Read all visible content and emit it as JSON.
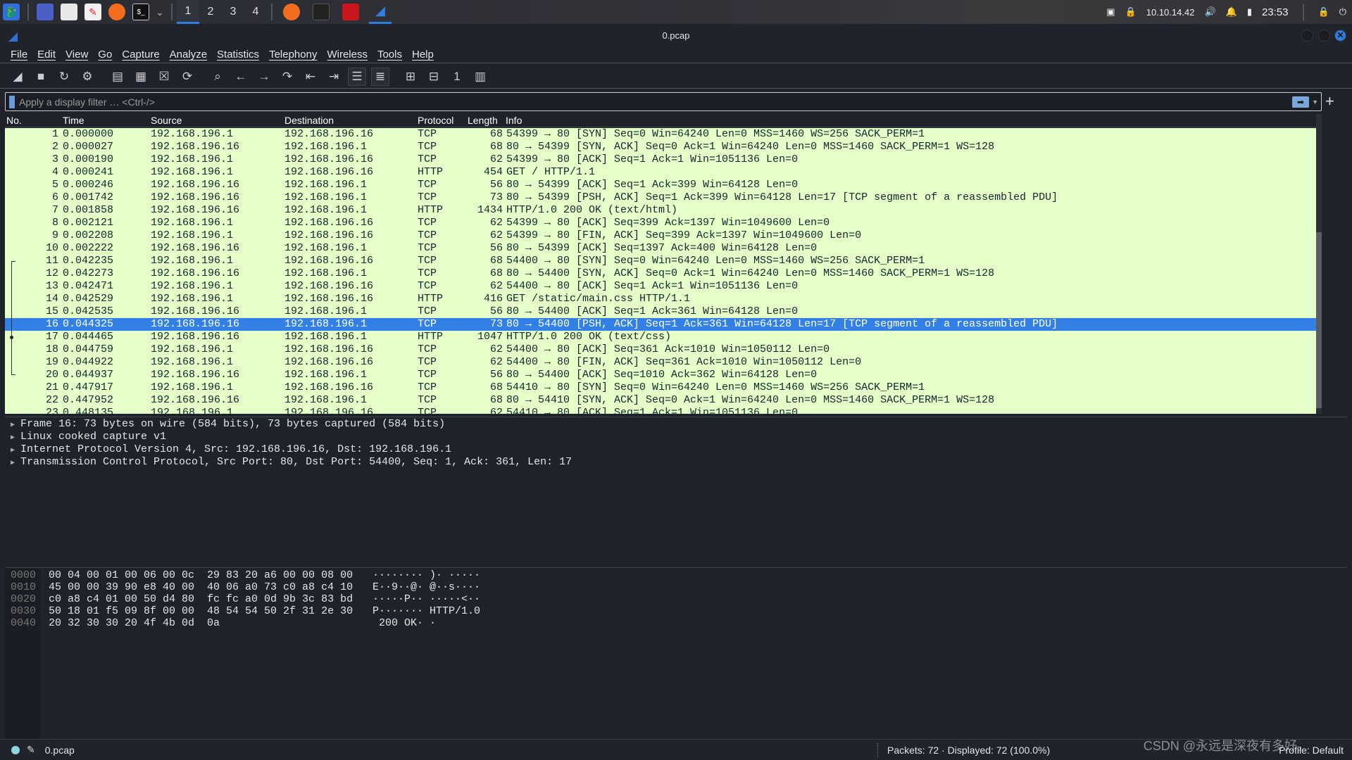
{
  "taskbar": {
    "workspaces": [
      "1",
      "2",
      "3",
      "4"
    ],
    "active_workspace": "1",
    "ip": "10.10.14.42",
    "time": "23:53"
  },
  "window": {
    "title": "0.pcap"
  },
  "menu": [
    "File",
    "Edit",
    "View",
    "Go",
    "Capture",
    "Analyze",
    "Statistics",
    "Telephony",
    "Wireless",
    "Tools",
    "Help"
  ],
  "toolbar": [
    "shark-fin-start-icon",
    "stop-icon",
    "restart-icon",
    "options-gear-icon",
    "open-file-icon",
    "save-file-icon",
    "close-file-icon",
    "reload-icon",
    "find-icon",
    "back-arrow-icon",
    "forward-arrow-icon",
    "go-to-packet-icon",
    "first-packet-icon",
    "last-packet-icon",
    "autoscroll-icon",
    "colorize-icon",
    "zoom-in-icon",
    "zoom-out-icon",
    "normal-size-icon",
    "resize-columns-icon"
  ],
  "filter": {
    "placeholder": "Apply a display filter … <Ctrl-/>",
    "value": ""
  },
  "columns": {
    "no": "No.",
    "time": "Time",
    "source": "Source",
    "destination": "Destination",
    "protocol": "Protocol",
    "length": "Length",
    "info": "Info"
  },
  "selected_packet": 16,
  "packets": [
    [
      "1",
      "0.000000",
      "192.168.196.1",
      "192.168.196.16",
      "TCP",
      "68",
      "54399 → 80 [SYN] Seq=0 Win=64240 Len=0 MSS=1460 WS=256 SACK_PERM=1"
    ],
    [
      "2",
      "0.000027",
      "192.168.196.16",
      "192.168.196.1",
      "TCP",
      "68",
      "80 → 54399 [SYN, ACK] Seq=0 Ack=1 Win=64240 Len=0 MSS=1460 SACK_PERM=1 WS=128"
    ],
    [
      "3",
      "0.000190",
      "192.168.196.1",
      "192.168.196.16",
      "TCP",
      "62",
      "54399 → 80 [ACK] Seq=1 Ack=1 Win=1051136 Len=0"
    ],
    [
      "4",
      "0.000241",
      "192.168.196.1",
      "192.168.196.16",
      "HTTP",
      "454",
      "GET / HTTP/1.1"
    ],
    [
      "5",
      "0.000246",
      "192.168.196.16",
      "192.168.196.1",
      "TCP",
      "56",
      "80 → 54399 [ACK] Seq=1 Ack=399 Win=64128 Len=0"
    ],
    [
      "6",
      "0.001742",
      "192.168.196.16",
      "192.168.196.1",
      "TCP",
      "73",
      "80 → 54399 [PSH, ACK] Seq=1 Ack=399 Win=64128 Len=17 [TCP segment of a reassembled PDU]"
    ],
    [
      "7",
      "0.001858",
      "192.168.196.16",
      "192.168.196.1",
      "HTTP",
      "1434",
      "HTTP/1.0 200 OK  (text/html)"
    ],
    [
      "8",
      "0.002121",
      "192.168.196.1",
      "192.168.196.16",
      "TCP",
      "62",
      "54399 → 80 [ACK] Seq=399 Ack=1397 Win=1049600 Len=0"
    ],
    [
      "9",
      "0.002208",
      "192.168.196.1",
      "192.168.196.16",
      "TCP",
      "62",
      "54399 → 80 [FIN, ACK] Seq=399 Ack=1397 Win=1049600 Len=0"
    ],
    [
      "10",
      "0.002222",
      "192.168.196.16",
      "192.168.196.1",
      "TCP",
      "56",
      "80 → 54399 [ACK] Seq=1397 Ack=400 Win=64128 Len=0"
    ],
    [
      "11",
      "0.042235",
      "192.168.196.1",
      "192.168.196.16",
      "TCP",
      "68",
      "54400 → 80 [SYN] Seq=0 Win=64240 Len=0 MSS=1460 WS=256 SACK_PERM=1"
    ],
    [
      "12",
      "0.042273",
      "192.168.196.16",
      "192.168.196.1",
      "TCP",
      "68",
      "80 → 54400 [SYN, ACK] Seq=0 Ack=1 Win=64240 Len=0 MSS=1460 SACK_PERM=1 WS=128"
    ],
    [
      "13",
      "0.042471",
      "192.168.196.1",
      "192.168.196.16",
      "TCP",
      "62",
      "54400 → 80 [ACK] Seq=1 Ack=1 Win=1051136 Len=0"
    ],
    [
      "14",
      "0.042529",
      "192.168.196.1",
      "192.168.196.16",
      "HTTP",
      "416",
      "GET /static/main.css HTTP/1.1"
    ],
    [
      "15",
      "0.042535",
      "192.168.196.16",
      "192.168.196.1",
      "TCP",
      "56",
      "80 → 54400 [ACK] Seq=1 Ack=361 Win=64128 Len=0"
    ],
    [
      "16",
      "0.044325",
      "192.168.196.16",
      "192.168.196.1",
      "TCP",
      "73",
      "80 → 54400 [PSH, ACK] Seq=1 Ack=361 Win=64128 Len=17 [TCP segment of a reassembled PDU]"
    ],
    [
      "17",
      "0.044465",
      "192.168.196.16",
      "192.168.196.1",
      "HTTP",
      "1047",
      "HTTP/1.0 200 OK  (text/css)"
    ],
    [
      "18",
      "0.044759",
      "192.168.196.1",
      "192.168.196.16",
      "TCP",
      "62",
      "54400 → 80 [ACK] Seq=361 Ack=1010 Win=1050112 Len=0"
    ],
    [
      "19",
      "0.044922",
      "192.168.196.1",
      "192.168.196.16",
      "TCP",
      "62",
      "54400 → 80 [FIN, ACK] Seq=361 Ack=1010 Win=1050112 Len=0"
    ],
    [
      "20",
      "0.044937",
      "192.168.196.16",
      "192.168.196.1",
      "TCP",
      "56",
      "80 → 54400 [ACK] Seq=1010 Ack=362 Win=64128 Len=0"
    ],
    [
      "21",
      "0.447917",
      "192.168.196.1",
      "192.168.196.16",
      "TCP",
      "68",
      "54410 → 80 [SYN] Seq=0 Win=64240 Len=0 MSS=1460 WS=256 SACK_PERM=1"
    ],
    [
      "22",
      "0.447952",
      "192.168.196.16",
      "192.168.196.1",
      "TCP",
      "68",
      "80 → 54410 [SYN, ACK] Seq=0 Ack=1 Win=64240 Len=0 MSS=1460 SACK_PERM=1 WS=128"
    ],
    [
      "23",
      "0.448135",
      "192.168.196.1",
      "192.168.196.16",
      "TCP",
      "62",
      "54410 → 80 [ACK] Seq=1 Ack=1 Win=1051136 Len=0"
    ]
  ],
  "details": [
    "Frame 16: 73 bytes on wire (584 bits), 73 bytes captured (584 bits)",
    "Linux cooked capture v1",
    "Internet Protocol Version 4, Src: 192.168.196.16, Dst: 192.168.196.1",
    "Transmission Control Protocol, Src Port: 80, Dst Port: 54400, Seq: 1, Ack: 361, Len: 17"
  ],
  "hex": [
    {
      "offset": "0000",
      "bytes": "00 04 00 01 00 06 00 0c  29 83 20 a6 00 00 08 00",
      "ascii": "········ )· ·····"
    },
    {
      "offset": "0010",
      "bytes": "45 00 00 39 90 e8 40 00  40 06 a0 73 c0 a8 c4 10",
      "ascii": "E··9··@· @··s····"
    },
    {
      "offset": "0020",
      "bytes": "c0 a8 c4 01 00 50 d4 80  fc fc a0 0d 9b 3c 83 bd",
      "ascii": "·····P·· ·····<··"
    },
    {
      "offset": "0030",
      "bytes": "50 18 01 f5 09 8f 00 00  48 54 54 50 2f 31 2e 30",
      "ascii": "P······· HTTP/1.0"
    },
    {
      "offset": "0040",
      "bytes": "20 32 30 30 20 4f 4b 0d  0a",
      "ascii": " 200 OK· ·"
    }
  ],
  "status": {
    "file": "0.pcap",
    "packets": "Packets: 72 · Displayed: 72 (100.0%)",
    "profile": "Profile: Default"
  },
  "watermark": "CSDN @永远是深夜有多好。",
  "colors": {
    "tcp_row": "#e4ffc7",
    "selected_row": "#3280e6",
    "accent": "#2f7de1"
  }
}
